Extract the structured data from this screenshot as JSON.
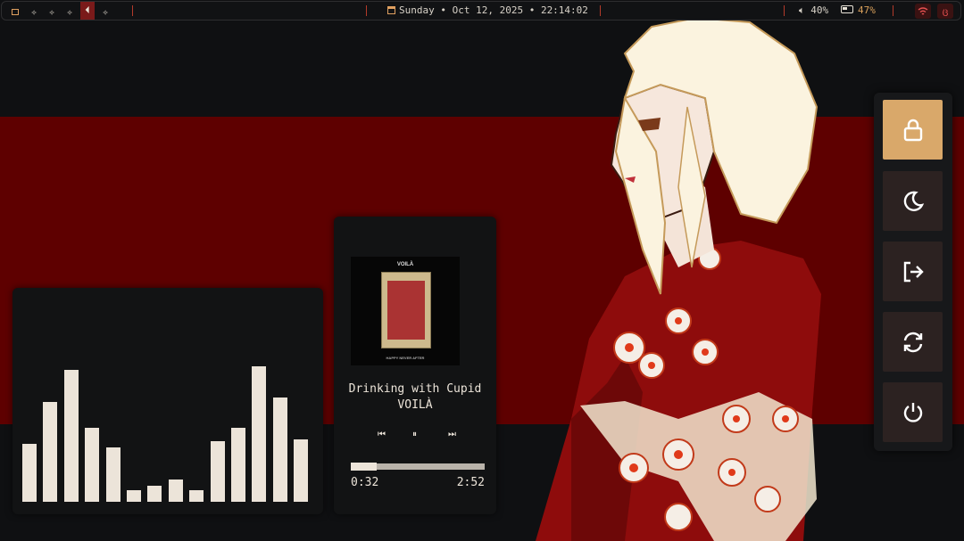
{
  "topbar": {
    "workspaces": [
      "✧",
      "✧",
      "✧",
      "⏴",
      "✧"
    ],
    "active_workspace": 4,
    "clock": "Sunday • Oct 12, 2025 • 22:14:02",
    "volume": "40%",
    "battery": "47%",
    "tray_icons": [
      "wifi-icon",
      "app-icon"
    ]
  },
  "visualizer": {
    "levels": [
      0.44,
      0.76,
      1.0,
      0.56,
      0.41,
      0.09,
      0.12,
      0.17,
      0.09,
      0.46,
      0.56,
      1.03,
      0.79,
      0.47
    ]
  },
  "player": {
    "album_title": "VOILÀ",
    "album_subtitle": "HAPPY NEVER AFTER",
    "song": "Drinking with Cupid",
    "artist": "VOILÀ",
    "prev": "⏮",
    "play_pause": "⏸",
    "next": "⏭",
    "elapsed": "0:32",
    "duration": "2:52",
    "progress": 0.19
  },
  "power_menu": {
    "items": [
      "lock",
      "sleep",
      "logout",
      "reboot",
      "shutdown"
    ],
    "selected": "lock",
    "selected_color": "#d9a86a"
  },
  "colors": {
    "bar_bg": "#111214",
    "accent_red": "#5e0000",
    "text": "#ece4d9"
  }
}
